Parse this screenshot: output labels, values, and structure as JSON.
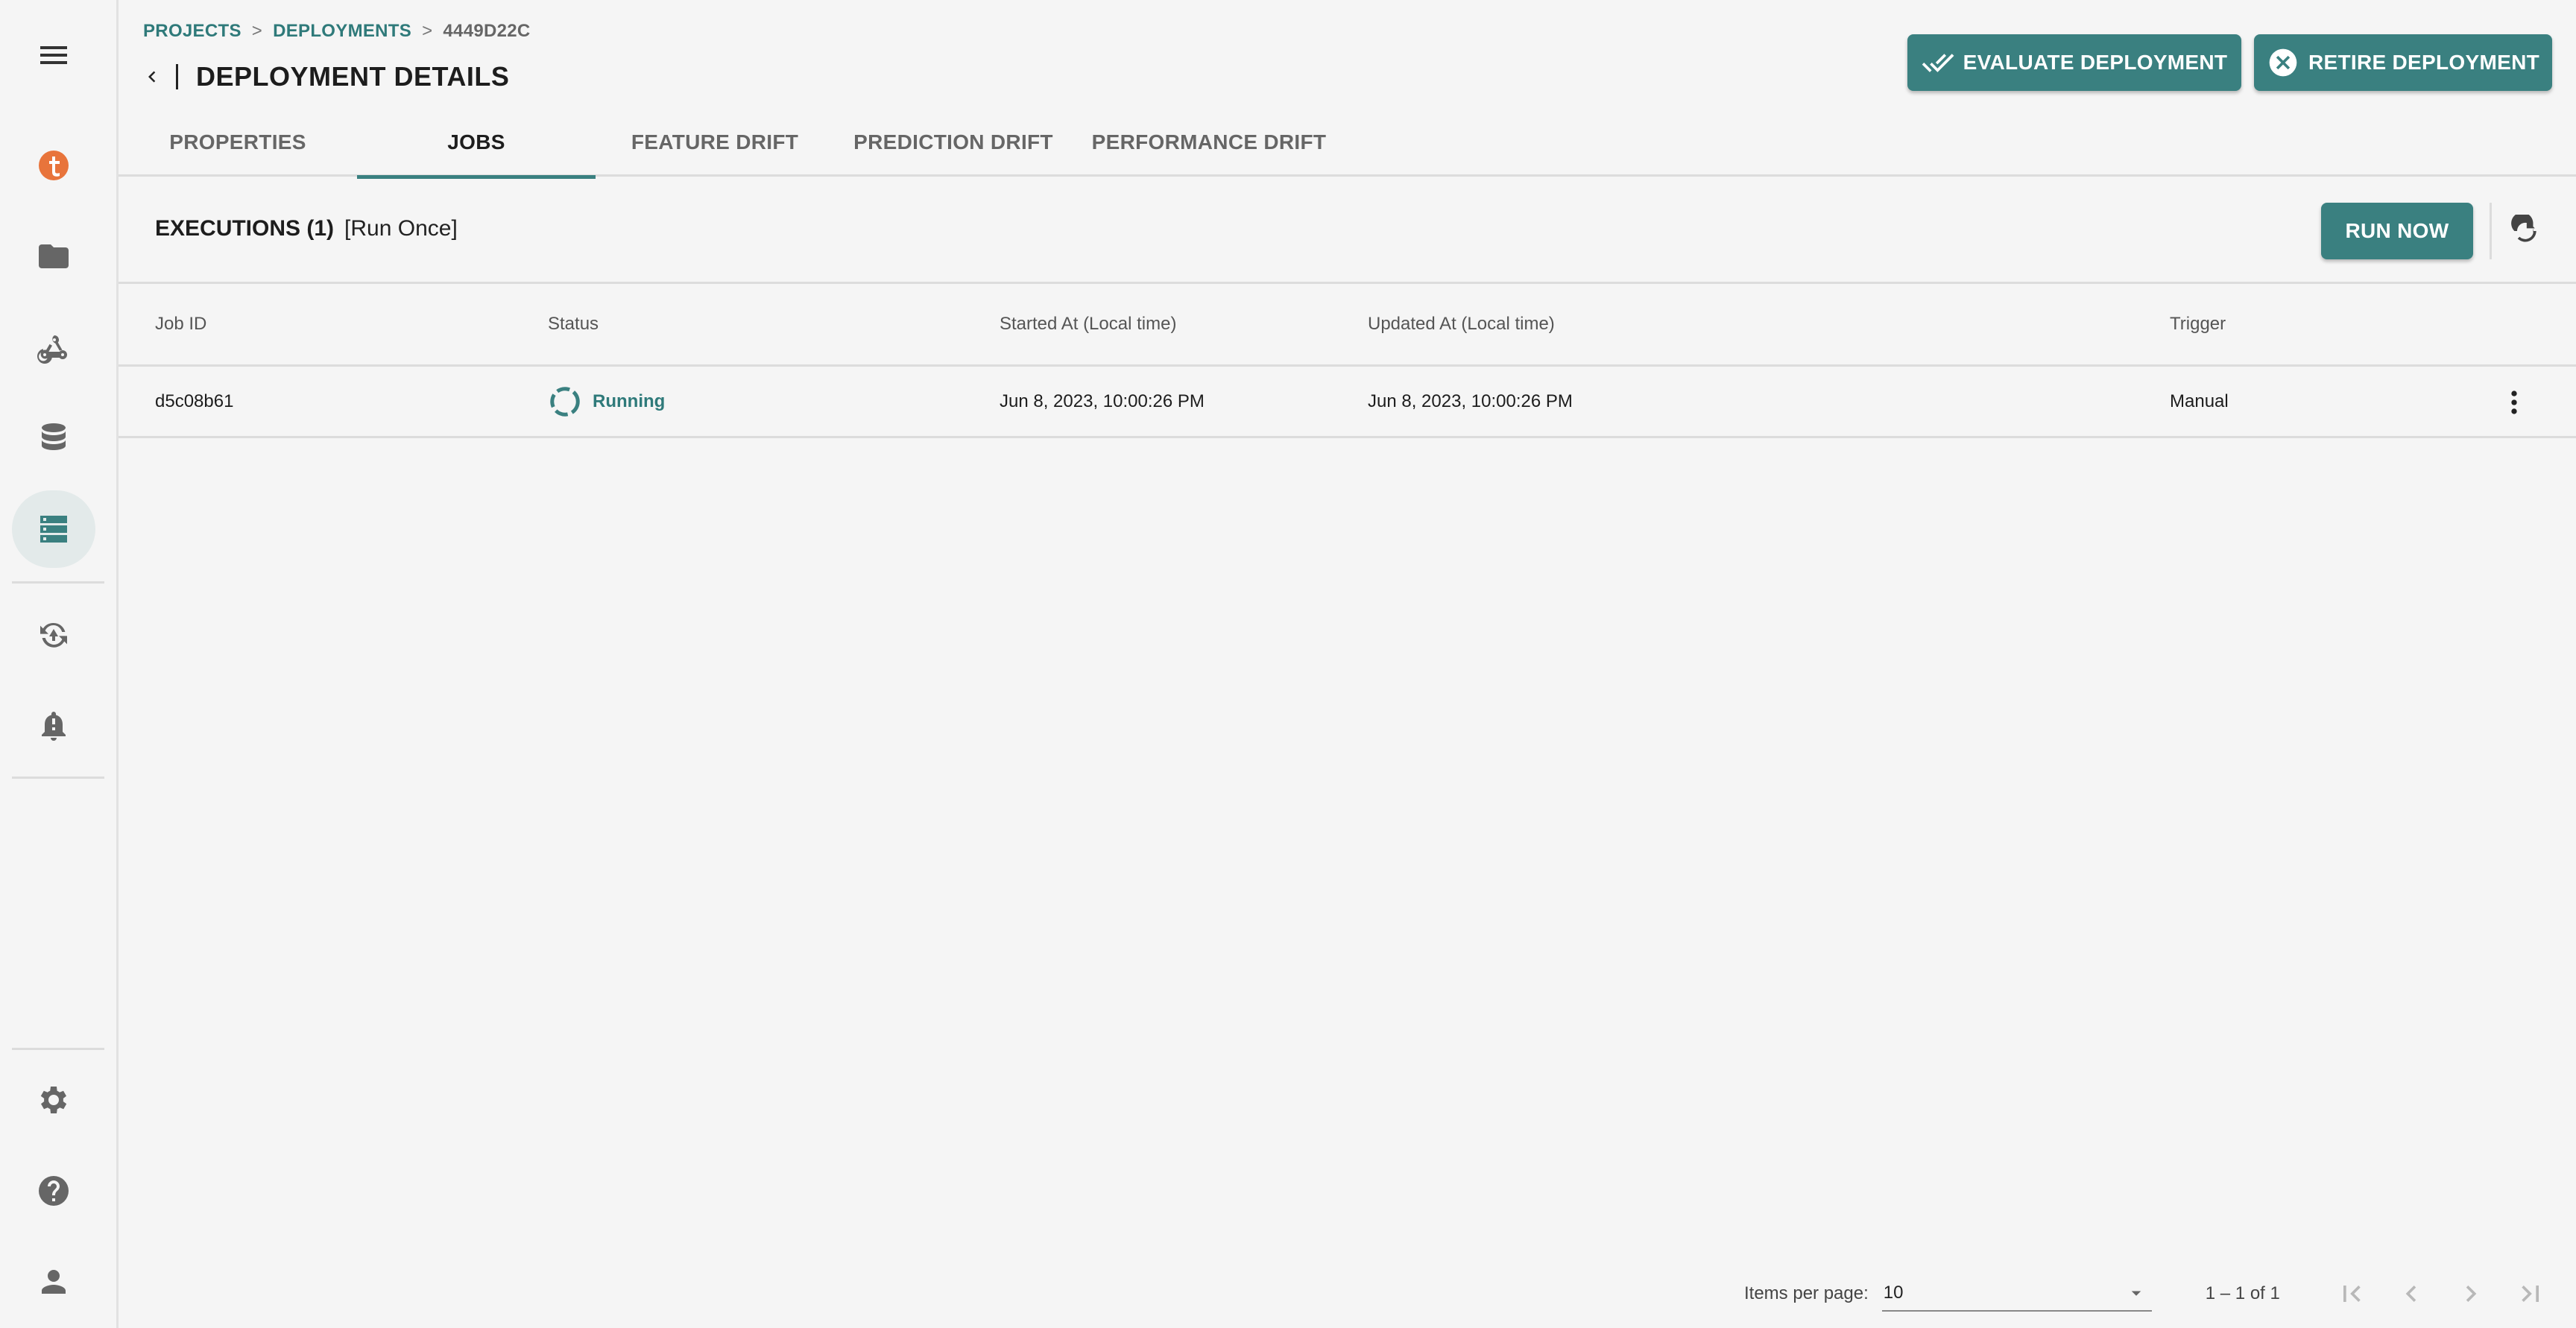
{
  "breadcrumb": {
    "projects": "PROJECTS",
    "deployments": "DEPLOYMENTS",
    "current": "4449D22C",
    "separator": ">"
  },
  "header": {
    "title": "DEPLOYMENT DETAILS",
    "evaluate_label": "EVALUATE DEPLOYMENT",
    "retire_label": "RETIRE DEPLOYMENT"
  },
  "tabs": [
    {
      "label": "PROPERTIES"
    },
    {
      "label": "JOBS"
    },
    {
      "label": "FEATURE DRIFT"
    },
    {
      "label": "PREDICTION DRIFT"
    },
    {
      "label": "PERFORMANCE DRIFT"
    }
  ],
  "active_tab": "JOBS",
  "executions": {
    "title": "EXECUTIONS (1)",
    "mode": "[Run Once]",
    "run_now_label": "RUN NOW"
  },
  "table": {
    "columns": [
      "Job ID",
      "Status",
      "Started At (Local time)",
      "Updated At (Local time)",
      "Trigger"
    ],
    "rows": [
      {
        "job_id": "d5c08b61",
        "status": "Running",
        "started_at": "Jun 8, 2023, 10:00:26 PM",
        "updated_at": "Jun 8, 2023, 10:00:26 PM",
        "trigger": "Manual"
      }
    ]
  },
  "paginator": {
    "items_per_page_label": "Items per page:",
    "items_per_page": "10",
    "range": "1 – 1 of 1"
  },
  "sidebar": {
    "icons": [
      "menu-icon",
      "logo-icon",
      "folder-icon",
      "webhook-icon",
      "database-icon",
      "deployments-icon",
      "monitoring-icon",
      "alerts-icon",
      "settings-icon",
      "help-icon",
      "account-icon"
    ]
  },
  "colors": {
    "accent": "#3a8080",
    "logo": "#e8743b",
    "background": "#f5f5f5"
  }
}
